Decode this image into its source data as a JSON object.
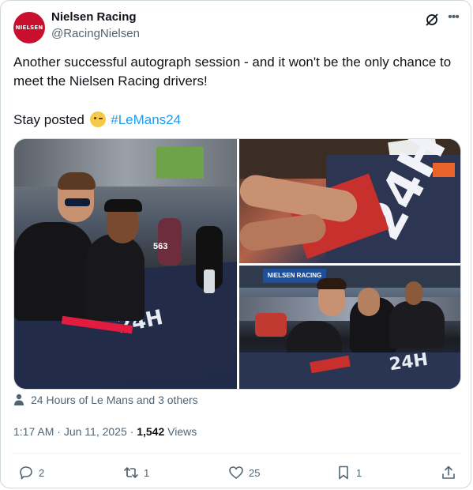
{
  "author": {
    "name": "Nielsen Racing",
    "handle": "@RacingNielsen",
    "avatar_text": "NIELSEN"
  },
  "post": {
    "line1": "Another successful autograph session - and it won't be the only chance to meet the Nielsen Racing drivers!",
    "line2_prefix": "Stay posted",
    "hashtag": "#LeMans24"
  },
  "media": {
    "photo1_number": "563",
    "photo3_banner": "NIELSEN RACING"
  },
  "tagged": "24 Hours of Le Mans and 3 others",
  "meta": {
    "time": "1:17 AM",
    "date": "Jun 11, 2025",
    "views_count": "1,542",
    "views_label": "Views"
  },
  "actions": {
    "replies": "2",
    "reposts": "1",
    "likes": "25",
    "bookmarks": "1"
  },
  "colors": {
    "link": "#1d9bf0",
    "secondary_text": "#536471",
    "brand_red": "#c8102e"
  }
}
